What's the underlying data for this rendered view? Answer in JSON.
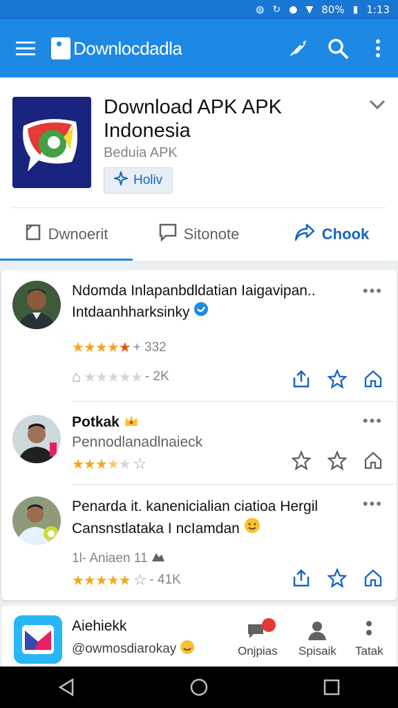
{
  "status_bar": {
    "battery": "80%",
    "time": "1:13"
  },
  "app_bar": {
    "title": "Downlocdadla"
  },
  "app_header": {
    "name": "Download APK APK Indonesia",
    "subtitle": "Beduia APK",
    "follow_label": "Holiv"
  },
  "tabs": [
    {
      "label": "Dwnoerit"
    },
    {
      "label": "Sitonote"
    },
    {
      "label": "Chook"
    }
  ],
  "reviews": [
    {
      "line1": "Ndomda Inlapanbdldatian Iaigavipan..",
      "line2": "Intdaanhharksinky",
      "rating_text": "+ 332",
      "count_text": "- 2K"
    },
    {
      "name": "Potkak",
      "subtitle": "Pennodlanadlnaieck"
    },
    {
      "line1": "Penarda it. kanenicialian ciatioa Hergil",
      "line2": "Cansnstlataka I ncIamdan",
      "date": "1l- Aniaen 11",
      "count_text": "- 41K"
    }
  ],
  "bottom_card": {
    "name": "Aiehiekk",
    "handle": "@owmosdiarokay",
    "nav": [
      {
        "label": "Onjpias"
      },
      {
        "label": "Spisaik"
      },
      {
        "label": "Tatak"
      }
    ]
  },
  "colors": {
    "primary": "#1e88e5",
    "status": "#1976d2",
    "star": "#f4a61a"
  }
}
